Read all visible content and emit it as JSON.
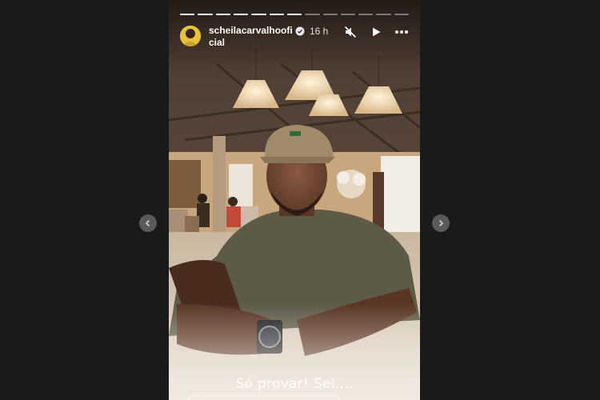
{
  "story": {
    "username": "scheilacarvalhoofi cial",
    "time": "16 h",
    "caption": "Só provar! Sei....",
    "progress": {
      "segments": 13,
      "completed": 7
    }
  },
  "icons": {
    "verified": "verified-badge-icon",
    "mute": "muted-speaker-icon",
    "play": "play-icon",
    "more": "more-options-icon",
    "prev": "chevron-left-icon",
    "next": "chevron-right-icon"
  }
}
